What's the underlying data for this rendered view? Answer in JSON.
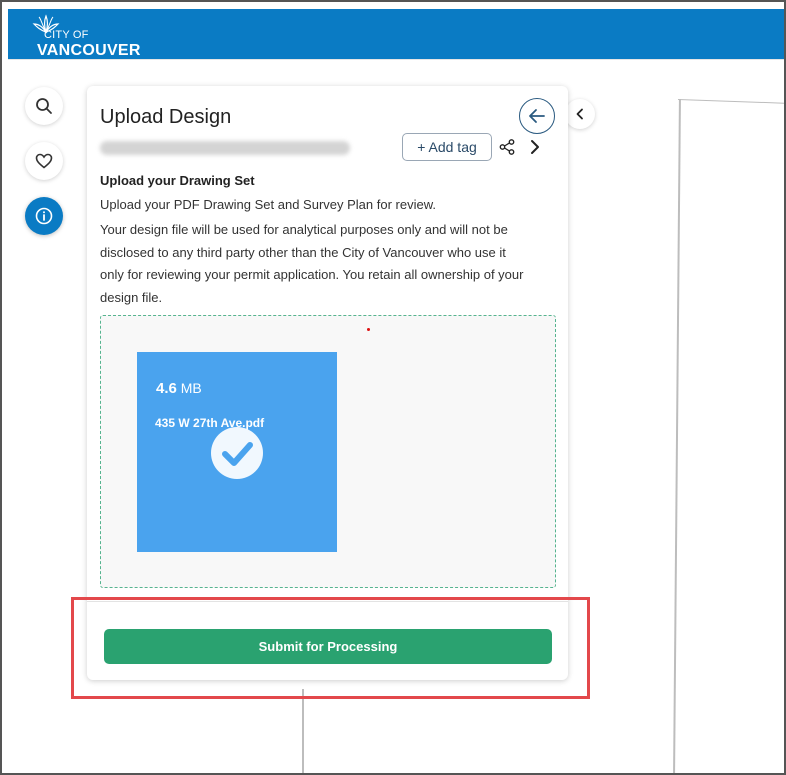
{
  "header": {
    "logo_top": "CITY OF",
    "logo_bottom": "VANCOUVER"
  },
  "sidebar": {
    "buttons": [
      {
        "icon": "search-icon"
      },
      {
        "icon": "heart-icon"
      },
      {
        "icon": "info-icon",
        "active": true
      }
    ]
  },
  "panel": {
    "title": "Upload Design",
    "add_tag_label": "+ Add tag",
    "section_heading": "Upload your Drawing Set",
    "instruction": "Upload your PDF Drawing Set and Survey Plan for review.",
    "disclaimer_lines": [
      "Your design file will be used for analytical purposes only and will not be",
      "disclosed to any third party other than the City of Vancouver who use it",
      "only for reviewing your permit application. You retain all ownership of your",
      "design file."
    ],
    "file": {
      "size_value": "4.6",
      "size_unit": "MB",
      "name": "435 W 27th Ave.pdf"
    },
    "submit_label": "Submit for Processing"
  },
  "colors": {
    "header_blue": "#0a7bc4",
    "file_card_blue": "#4aa3ee",
    "submit_green": "#2aa270",
    "highlight_red": "#e3484b"
  }
}
